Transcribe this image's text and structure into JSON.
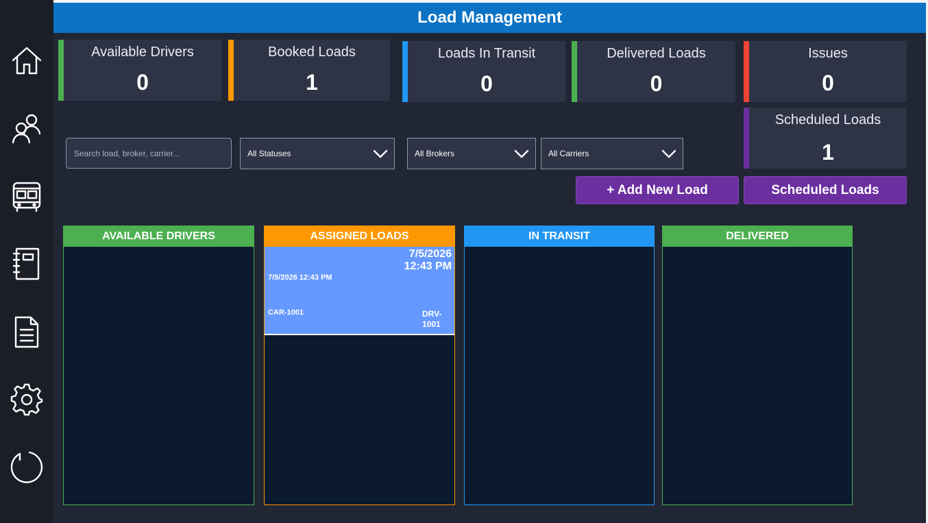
{
  "header": {
    "title": "Load Management"
  },
  "sidebar": {
    "items": [
      {
        "icon": "home-icon"
      },
      {
        "icon": "users-icon"
      },
      {
        "icon": "bus-icon"
      },
      {
        "icon": "notebook-icon"
      },
      {
        "icon": "document-icon"
      },
      {
        "icon": "gear-icon"
      },
      {
        "icon": "refresh-icon"
      }
    ]
  },
  "kpis": {
    "available_drivers": {
      "label": "Available Drivers",
      "value": "0",
      "color": "#4caf50"
    },
    "booked_loads": {
      "label": "Booked Loads",
      "value": "1",
      "color": "#ff9800"
    },
    "loads_in_transit": {
      "label": "Loads In Transit",
      "value": "0",
      "color": "#2196f3"
    },
    "delivered_loads": {
      "label": "Delivered Loads",
      "value": "0",
      "color": "#4caf50"
    },
    "issues": {
      "label": "Issues",
      "value": "0",
      "color": "#f44336"
    },
    "scheduled_loads": {
      "label": "Scheduled Loads",
      "value": "1",
      "color": "#6b2fa0"
    }
  },
  "filters": {
    "search_placeholder": "Search load, broker, carrier...",
    "status": "All Statuses",
    "broker": "All Brokers",
    "carrier": "All Carriers"
  },
  "buttons": {
    "add_load": "+ Add New Load",
    "scheduled_loads": "Scheduled Loads"
  },
  "columns": {
    "available_drivers": {
      "title": "AVAILABLE DRIVERS",
      "color": "#4caf50"
    },
    "assigned_loads": {
      "title": "ASSIGNED LOADS",
      "color": "#ff9800"
    },
    "in_transit": {
      "title": "IN TRANSIT",
      "color": "#2196f3"
    },
    "delivered": {
      "title": "DELIVERED",
      "color": "#4caf50"
    }
  },
  "assigned_cards": [
    {
      "date": "7/5/2026",
      "time": "12:43 PM",
      "scheduled": "7/5/2026 12:43 PM",
      "carrier": "CAR-1001",
      "driver": "DRV-1001"
    }
  ]
}
